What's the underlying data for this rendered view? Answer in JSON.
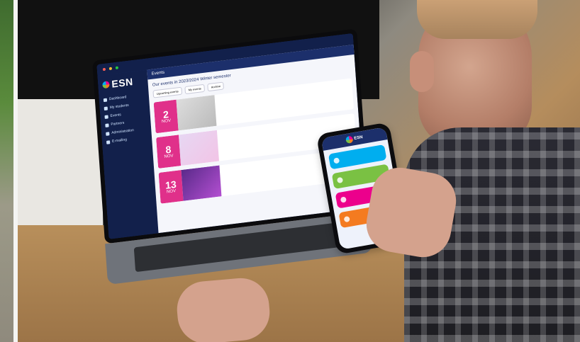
{
  "scene": {
    "laptop": {
      "brand": "ESN",
      "page_header": "Events",
      "events_title": "Our events in 2023/2024 Winter semester",
      "tabs": [
        "Upcoming events",
        "My events",
        "Archive"
      ],
      "sidebar_items": [
        "Dashboard",
        "My students",
        "Events",
        "Partners",
        "Administration",
        "E-mailing"
      ],
      "events": [
        {
          "day": "2",
          "month": "NOV"
        },
        {
          "day": "8",
          "month": "NOV"
        },
        {
          "day": "13",
          "month": "NOV"
        }
      ]
    },
    "phone": {
      "brand": "ESN"
    }
  },
  "colors": {
    "esn_blue": "#00aeef",
    "esn_green": "#7ac143",
    "esn_magenta": "#ec008c",
    "esn_orange": "#f47b20",
    "esn_navy": "#1c2f6b",
    "event_date_pink": "#e0308a"
  },
  "icons": {
    "esn_star": "esn-star-icon",
    "sidebar_nav": "square-icon"
  }
}
